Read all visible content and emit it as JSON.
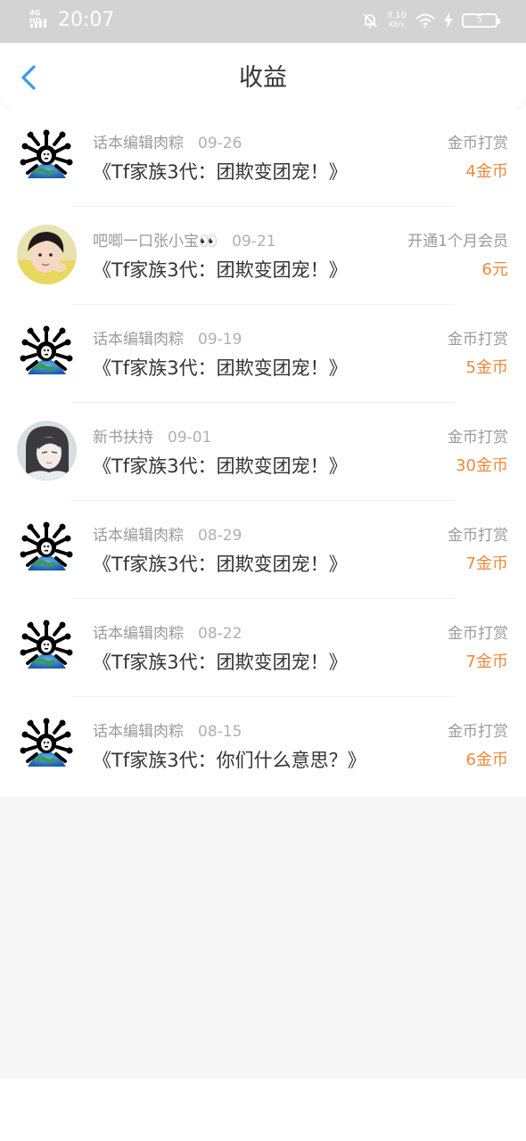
{
  "status_bar": {
    "network": "4G HD",
    "time": "20:07",
    "speed_value": "3.10",
    "speed_unit": "KB/s",
    "battery_level": "5"
  },
  "header": {
    "title": "收益"
  },
  "colors": {
    "accent_blue": "#3a9be8",
    "amount_orange": "#f0883c"
  },
  "items": [
    {
      "avatar": "skull-globe",
      "name": "话本编辑肉粽",
      "date": "09-26",
      "title": "《Tf家族3代：团欺变团宠！》",
      "type": "金币打赏",
      "amount": "4金币"
    },
    {
      "avatar": "user-photo-boy",
      "name": "吧唧一口张小宝👀",
      "date": "09-21",
      "title": "《Tf家族3代：团欺变团宠！》",
      "type": "开通1个月会员",
      "amount": "6元"
    },
    {
      "avatar": "skull-globe",
      "name": "话本编辑肉粽",
      "date": "09-19",
      "title": "《Tf家族3代：团欺变团宠！》",
      "type": "金币打赏",
      "amount": "5金币"
    },
    {
      "avatar": "anime-portrait",
      "name": "新书扶持",
      "date": "09-01",
      "title": "《Tf家族3代：团欺变团宠！》",
      "type": "金币打赏",
      "amount": "30金币"
    },
    {
      "avatar": "skull-globe",
      "name": "话本编辑肉粽",
      "date": "08-29",
      "title": "《Tf家族3代：团欺变团宠！》",
      "type": "金币打赏",
      "amount": "7金币"
    },
    {
      "avatar": "skull-globe",
      "name": "话本编辑肉粽",
      "date": "08-22",
      "title": "《Tf家族3代：团欺变团宠！》",
      "type": "金币打赏",
      "amount": "7金币"
    },
    {
      "avatar": "skull-globe",
      "name": "话本编辑肉粽",
      "date": "08-15",
      "title": "《Tf家族3代：你们什么意思？》",
      "type": "金币打赏",
      "amount": "6金币"
    }
  ]
}
